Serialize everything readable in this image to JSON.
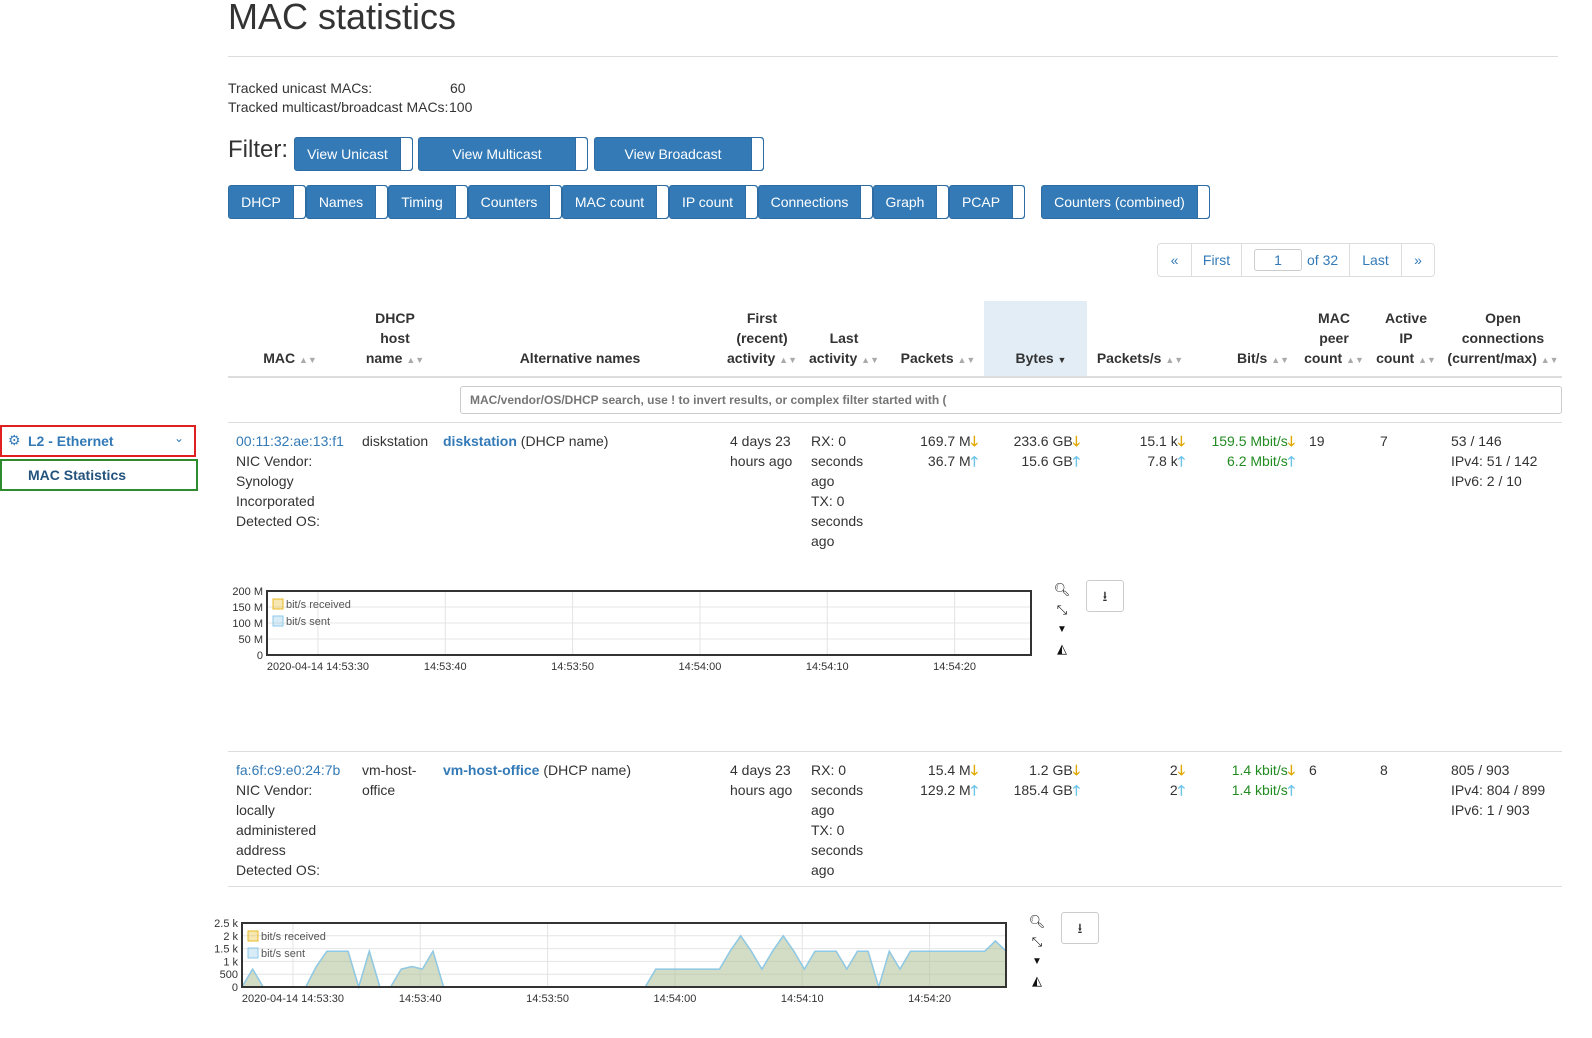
{
  "page": {
    "title": "MAC statistics"
  },
  "summary": {
    "unicast_label": "Tracked unicast MACs:",
    "unicast_value": "60",
    "multicast_label": "Tracked multicast/broadcast MACs:",
    "multicast_value": "100"
  },
  "filter": {
    "label": "Filter:",
    "view_buttons": [
      "View Unicast",
      "View Multicast",
      "View Broadcast"
    ],
    "column_buttons": [
      "DHCP",
      "Names",
      "Timing",
      "Counters",
      "MAC count",
      "IP count",
      "Connections",
      "Graph",
      "PCAP"
    ],
    "combined_button": "Counters (combined)"
  },
  "pagination": {
    "prev": "«",
    "first": "First",
    "page": "1",
    "of": "of 32",
    "last": "Last",
    "next": "»"
  },
  "sidebar": {
    "group": "L2 - Ethernet",
    "item": "MAC Statistics"
  },
  "table": {
    "headers": {
      "mac": [
        "MAC"
      ],
      "dhcp": [
        "DHCP",
        "host",
        "name"
      ],
      "alt": [
        "Alternative names"
      ],
      "first": [
        "First",
        "(recent)",
        "activity"
      ],
      "last": [
        "Last",
        "activity"
      ],
      "packets": [
        "Packets"
      ],
      "bytes": [
        "Bytes"
      ],
      "pps": [
        "Packets/s"
      ],
      "bps": [
        "Bit/s"
      ],
      "peers": [
        "MAC",
        "peer",
        "count"
      ],
      "ips": [
        "Active",
        "IP",
        "count"
      ],
      "conns": [
        "Open",
        "connections",
        "(current/max)"
      ]
    },
    "search_placeholder": "MAC/vendor/OS/DHCP search, use ! to invert results, or complex filter started with (",
    "rows": [
      {
        "mac": "00:11:32:ae:13:f1",
        "vendor": [
          "NIC Vendor:",
          "Synology",
          "Incorporated",
          "Detected OS:"
        ],
        "dhcp": [
          "diskstation"
        ],
        "alt_name": "diskstation",
        "alt_suffix": " (DHCP name)",
        "first": [
          "4 days 23",
          "hours ago"
        ],
        "last": [
          "RX: 0",
          "seconds",
          "ago",
          "TX: 0",
          "seconds",
          "ago"
        ],
        "packets_rx": "169.7 M",
        "packets_tx": "36.7 M",
        "bytes_rx": "233.6 GB",
        "bytes_tx": "15.6 GB",
        "pps_rx": "15.1 k",
        "pps_tx": "7.8 k",
        "bps_rx": "159.5 Mbit/s",
        "bps_tx": "6.2 Mbit/s",
        "peers": "19",
        "ips": "7",
        "conns": [
          "53 / 146",
          "IPv4: 51 / 142",
          "IPv6: 2 / 10"
        ]
      },
      {
        "mac": "fa:6f:c9:e0:24:7b",
        "vendor": [
          "NIC Vendor:",
          "locally",
          "administered",
          "address",
          "Detected OS:"
        ],
        "dhcp": [
          "vm-host-",
          "office"
        ],
        "alt_name": "vm-host-office",
        "alt_suffix": " (DHCP name)",
        "first": [
          "4 days 23",
          "hours ago"
        ],
        "last": [
          "RX: 0",
          "seconds",
          "ago",
          "TX: 0",
          "seconds",
          "ago"
        ],
        "packets_rx": "15.4 M",
        "packets_tx": "129.2 M",
        "bytes_rx": "1.2 GB",
        "bytes_tx": "185.4 GB",
        "pps_rx": "2",
        "pps_tx": "2",
        "bps_rx": "1.4 kbit/s",
        "bps_tx": "1.4 kbit/s",
        "peers": "6",
        "ips": "8",
        "conns": [
          "805 / 903",
          "IPv4: 804 / 899",
          "IPv6: 1 / 903"
        ]
      }
    ]
  },
  "colors": {
    "received": "#e8b923",
    "sent": "#8ec9e8",
    "accent": "#337ab7"
  },
  "chart_data": [
    {
      "type": "area",
      "ylim": [
        0,
        200000000
      ],
      "y_ticks": [
        "0",
        "50 M",
        "100 M",
        "150 M",
        "200 M"
      ],
      "x_ticks": [
        "2020-04-14 14:53:30",
        "14:53:40",
        "14:53:50",
        "14:54:00",
        "14:54:10",
        "14:54:20"
      ],
      "series": [
        {
          "name": "bit/s received",
          "values": [
            5,
            10,
            30,
            20,
            8,
            5,
            2,
            2,
            5,
            3,
            3,
            70,
            40,
            5,
            2,
            20,
            140,
            10,
            2,
            3,
            5,
            120,
            20,
            3,
            5,
            3,
            2,
            5,
            150,
            30,
            5,
            2,
            3,
            50,
            5,
            3,
            2,
            5,
            3,
            2,
            5,
            3,
            20,
            5,
            3,
            2,
            5,
            3,
            3,
            5,
            3,
            5,
            80,
            150,
            60,
            5,
            5,
            3,
            20,
            5,
            5,
            3,
            5,
            80,
            10,
            5,
            3,
            2,
            5,
            5,
            140,
            20,
            3,
            2,
            5,
            3,
            3,
            5,
            160
          ]
        },
        {
          "name": "bit/s sent",
          "values": [
            3,
            3,
            5,
            5,
            3,
            3,
            2,
            2,
            3,
            2,
            2,
            5,
            5,
            3,
            2,
            3,
            6,
            3,
            2,
            2,
            3,
            6,
            3,
            2,
            3,
            2,
            2,
            3,
            6,
            3,
            3,
            2,
            2,
            4,
            3,
            2,
            2,
            3,
            2,
            2,
            3,
            2,
            3,
            3,
            2,
            2,
            3,
            2,
            2,
            3,
            2,
            3,
            5,
            6,
            4,
            3,
            3,
            2,
            3,
            3,
            3,
            2,
            3,
            5,
            3,
            3,
            2,
            2,
            3,
            3,
            6,
            3,
            2,
            2,
            3,
            2,
            2,
            3,
            6
          ]
        }
      ]
    },
    {
      "type": "area",
      "ylim": [
        0,
        2500
      ],
      "y_ticks": [
        "0",
        "500",
        "1 k",
        "1.5 k",
        "2 k",
        "2.5 k"
      ],
      "x_ticks": [
        "2020-04-14 14:53:30",
        "14:53:40",
        "14:53:50",
        "14:54:00",
        "14:54:10",
        "14:54:20"
      ],
      "series": [
        {
          "name": "bit/s received",
          "values": [
            0,
            700,
            0,
            0,
            0,
            0,
            0,
            800,
            1400,
            1400,
            1400,
            0,
            1400,
            0,
            0,
            700,
            800,
            700,
            1400,
            0,
            0,
            0,
            0,
            0,
            0,
            0,
            0,
            0,
            0,
            0,
            0,
            0,
            0,
            0,
            0,
            0,
            0,
            0,
            0,
            700,
            700,
            700,
            700,
            700,
            700,
            700,
            1400,
            2000,
            1400,
            700,
            1400,
            2000,
            1400,
            700,
            1400,
            1400,
            1400,
            700,
            1400,
            1400,
            0,
            1400,
            700,
            1400,
            1400,
            1400,
            1400,
            1400,
            1400,
            1400,
            1400,
            1800,
            1400
          ]
        },
        {
          "name": "bit/s sent",
          "values": [
            0,
            700,
            0,
            0,
            0,
            0,
            0,
            800,
            1400,
            1400,
            1400,
            0,
            1400,
            0,
            0,
            700,
            800,
            700,
            1400,
            0,
            0,
            0,
            0,
            0,
            0,
            0,
            0,
            0,
            0,
            0,
            0,
            0,
            0,
            0,
            0,
            0,
            0,
            0,
            0,
            700,
            700,
            700,
            700,
            700,
            700,
            700,
            1400,
            2000,
            1400,
            700,
            1400,
            2000,
            1400,
            700,
            1400,
            1400,
            1400,
            700,
            1400,
            1400,
            0,
            1400,
            700,
            1400,
            1400,
            1400,
            1400,
            1400,
            1400,
            1400,
            1400,
            1800,
            1400
          ]
        }
      ]
    }
  ]
}
